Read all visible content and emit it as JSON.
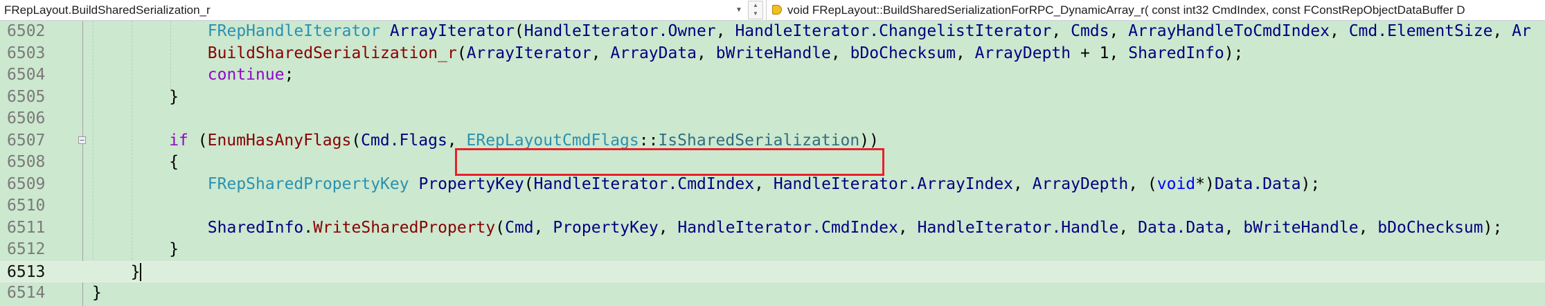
{
  "navbar": {
    "scope_dropdown": "FRepLayout.BuildSharedSerialization_r",
    "member_dropdown": "void FRepLayout::BuildSharedSerializationForRPC_DynamicArray_r( const int32 CmdIndex, const FConstRepObjectDataBuffer D",
    "member_icon": "method-icon"
  },
  "colors": {
    "background": "#cce8cf",
    "type": "#2b91af",
    "variable": "#000080",
    "function": "#880000",
    "keyword": "#8f08c4",
    "highlight_box": "#e8202a"
  },
  "code": {
    "current_line": "6513",
    "highlighted_text": "ERepLayoutCmdFlags::IsSharedSerialization)",
    "lines": [
      {
        "n": "6502",
        "indent": 3,
        "tokens": [
          {
            "c": "type",
            "t": "FRepHandleIterator"
          },
          {
            "c": "p",
            "t": " "
          },
          {
            "c": "var",
            "t": "ArrayIterator"
          },
          {
            "c": "p",
            "t": "("
          },
          {
            "c": "var",
            "t": "HandleIterator.Owner"
          },
          {
            "c": "p",
            "t": ", "
          },
          {
            "c": "var",
            "t": "HandleIterator.ChangelistIterator"
          },
          {
            "c": "p",
            "t": ", "
          },
          {
            "c": "var",
            "t": "Cmds"
          },
          {
            "c": "p",
            "t": ", "
          },
          {
            "c": "var",
            "t": "ArrayHandleToCmdIndex"
          },
          {
            "c": "p",
            "t": ", "
          },
          {
            "c": "var",
            "t": "Cmd.ElementSize"
          },
          {
            "c": "p",
            "t": ", "
          },
          {
            "c": "var",
            "t": "Ar"
          }
        ]
      },
      {
        "n": "6503",
        "indent": 3,
        "tokens": [
          {
            "c": "fn",
            "t": "BuildSharedSerialization_r"
          },
          {
            "c": "p",
            "t": "("
          },
          {
            "c": "var",
            "t": "ArrayIterator"
          },
          {
            "c": "p",
            "t": ", "
          },
          {
            "c": "var",
            "t": "ArrayData"
          },
          {
            "c": "p",
            "t": ", "
          },
          {
            "c": "var",
            "t": "bWriteHandle"
          },
          {
            "c": "p",
            "t": ", "
          },
          {
            "c": "var",
            "t": "bDoChecksum"
          },
          {
            "c": "p",
            "t": ", "
          },
          {
            "c": "var",
            "t": "ArrayDepth"
          },
          {
            "c": "p",
            "t": " + 1, "
          },
          {
            "c": "var",
            "t": "SharedInfo"
          },
          {
            "c": "p",
            "t": ");"
          }
        ]
      },
      {
        "n": "6504",
        "indent": 3,
        "tokens": [
          {
            "c": "kw",
            "t": "continue"
          },
          {
            "c": "p",
            "t": ";"
          }
        ]
      },
      {
        "n": "6505",
        "indent": 2,
        "tokens": [
          {
            "c": "p",
            "t": "}"
          }
        ]
      },
      {
        "n": "6506",
        "indent": 0,
        "tokens": []
      },
      {
        "n": "6507",
        "indent": 2,
        "tokens": [
          {
            "c": "kw",
            "t": "if"
          },
          {
            "c": "p",
            "t": " ("
          },
          {
            "c": "fn",
            "t": "EnumHasAnyFlags"
          },
          {
            "c": "p",
            "t": "("
          },
          {
            "c": "var",
            "t": "Cmd.Flags"
          },
          {
            "c": "p",
            "t": ", "
          },
          {
            "c": "type",
            "t": "ERepLayoutCmdFlags"
          },
          {
            "c": "p",
            "t": "::"
          },
          {
            "c": "enum",
            "t": "IsSharedSerialization"
          },
          {
            "c": "p",
            "t": "))"
          }
        ]
      },
      {
        "n": "6508",
        "indent": 2,
        "tokens": [
          {
            "c": "p",
            "t": "{"
          }
        ]
      },
      {
        "n": "6509",
        "indent": 3,
        "tokens": [
          {
            "c": "type",
            "t": "FRepSharedPropertyKey"
          },
          {
            "c": "p",
            "t": " "
          },
          {
            "c": "var",
            "t": "PropertyKey"
          },
          {
            "c": "p",
            "t": "("
          },
          {
            "c": "var",
            "t": "HandleIterator.CmdIndex"
          },
          {
            "c": "p",
            "t": ", "
          },
          {
            "c": "var",
            "t": "HandleIterator.ArrayIndex"
          },
          {
            "c": "p",
            "t": ", "
          },
          {
            "c": "var",
            "t": "ArrayDepth"
          },
          {
            "c": "p",
            "t": ", ("
          },
          {
            "c": "void",
            "t": "void"
          },
          {
            "c": "p",
            "t": "*)"
          },
          {
            "c": "var",
            "t": "Data.Data"
          },
          {
            "c": "p",
            "t": ");"
          }
        ]
      },
      {
        "n": "6510",
        "indent": 0,
        "tokens": []
      },
      {
        "n": "6511",
        "indent": 3,
        "tokens": [
          {
            "c": "var",
            "t": "SharedInfo"
          },
          {
            "c": "p",
            "t": "."
          },
          {
            "c": "fn",
            "t": "WriteSharedProperty"
          },
          {
            "c": "p",
            "t": "("
          },
          {
            "c": "var",
            "t": "Cmd"
          },
          {
            "c": "p",
            "t": ", "
          },
          {
            "c": "var",
            "t": "PropertyKey"
          },
          {
            "c": "p",
            "t": ", "
          },
          {
            "c": "var",
            "t": "HandleIterator.CmdIndex"
          },
          {
            "c": "p",
            "t": ", "
          },
          {
            "c": "var",
            "t": "HandleIterator.Handle"
          },
          {
            "c": "p",
            "t": ", "
          },
          {
            "c": "var",
            "t": "Data.Data"
          },
          {
            "c": "p",
            "t": ", "
          },
          {
            "c": "var",
            "t": "bWriteHandle"
          },
          {
            "c": "p",
            "t": ", "
          },
          {
            "c": "var",
            "t": "bDoChecksum"
          },
          {
            "c": "p",
            "t": ");"
          }
        ]
      },
      {
        "n": "6512",
        "indent": 2,
        "tokens": [
          {
            "c": "p",
            "t": "}"
          }
        ]
      },
      {
        "n": "6513",
        "indent": 1,
        "tokens": [
          {
            "c": "p",
            "t": "}"
          }
        ]
      },
      {
        "n": "6514",
        "indent": 0,
        "tokens": [
          {
            "c": "p",
            "t": "}"
          }
        ]
      }
    ]
  }
}
